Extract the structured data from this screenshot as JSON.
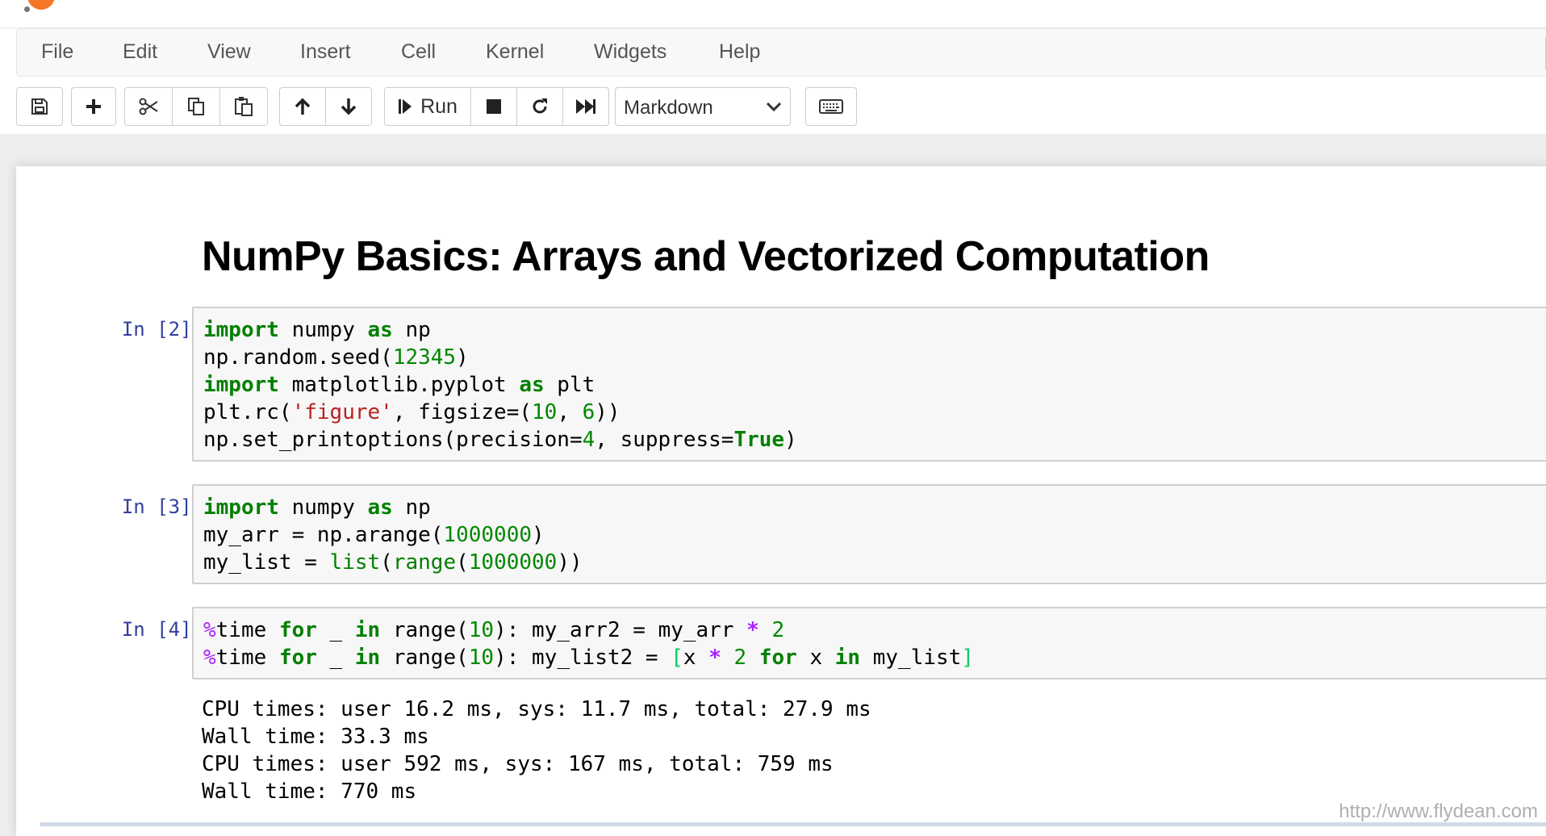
{
  "menubar": {
    "items": [
      "File",
      "Edit",
      "View",
      "Insert",
      "Cell",
      "Kernel",
      "Widgets",
      "Help"
    ]
  },
  "toolbar": {
    "run_label": "Run",
    "cell_type": "Markdown"
  },
  "notebook": {
    "title": "NumPy Basics: Arrays and Vectorized Computation",
    "cells": [
      {
        "prompt": "In [2]:",
        "lines": [
          [
            [
              "kw",
              "import"
            ],
            [
              "t",
              " numpy "
            ],
            [
              "kw",
              "as"
            ],
            [
              "t",
              " np"
            ]
          ],
          [
            [
              "t",
              "np.random.seed("
            ],
            [
              "num",
              "12345"
            ],
            [
              "t",
              ")"
            ]
          ],
          [
            [
              "kw",
              "import"
            ],
            [
              "t",
              " matplotlib.pyplot "
            ],
            [
              "kw",
              "as"
            ],
            [
              "t",
              " plt"
            ]
          ],
          [
            [
              "t",
              "plt.rc("
            ],
            [
              "str",
              "'figure'"
            ],
            [
              "t",
              ", figsize=("
            ],
            [
              "num",
              "10"
            ],
            [
              "t",
              ", "
            ],
            [
              "num",
              "6"
            ],
            [
              "t",
              "))"
            ]
          ],
          [
            [
              "t",
              "np.set_printoptions(precision="
            ],
            [
              "num",
              "4"
            ],
            [
              "t",
              ", suppress="
            ],
            [
              "kw",
              "True"
            ],
            [
              "t",
              ")"
            ]
          ]
        ]
      },
      {
        "prompt": "In [3]:",
        "lines": [
          [
            [
              "kw",
              "import"
            ],
            [
              "t",
              " numpy "
            ],
            [
              "kw",
              "as"
            ],
            [
              "t",
              " np"
            ]
          ],
          [
            [
              "t",
              "my_arr = np.arange("
            ],
            [
              "num",
              "1000000"
            ],
            [
              "t",
              ")"
            ]
          ],
          [
            [
              "t",
              "my_list = "
            ],
            [
              "bi",
              "list"
            ],
            [
              "t",
              "("
            ],
            [
              "bi",
              "range"
            ],
            [
              "t",
              "("
            ],
            [
              "num",
              "1000000"
            ],
            [
              "t",
              "))"
            ]
          ]
        ]
      },
      {
        "prompt": "In [4]:",
        "lines": [
          [
            [
              "magic",
              "%"
            ],
            [
              "t",
              "time "
            ],
            [
              "kw",
              "for"
            ],
            [
              "t",
              " _ "
            ],
            [
              "kw",
              "in"
            ],
            [
              "t",
              " range("
            ],
            [
              "num",
              "10"
            ],
            [
              "t",
              "): my_arr2 = my_arr "
            ],
            [
              "op",
              "*"
            ],
            [
              "t",
              " "
            ],
            [
              "num",
              "2"
            ]
          ],
          [
            [
              "magic",
              "%"
            ],
            [
              "t",
              "time "
            ],
            [
              "kw",
              "for"
            ],
            [
              "t",
              " _ "
            ],
            [
              "kw",
              "in"
            ],
            [
              "t",
              " range("
            ],
            [
              "num",
              "10"
            ],
            [
              "t",
              "): my_list2 = "
            ],
            [
              "br",
              "["
            ],
            [
              "t",
              "x "
            ],
            [
              "op",
              "*"
            ],
            [
              "t",
              " "
            ],
            [
              "num",
              "2"
            ],
            [
              "t",
              " "
            ],
            [
              "kw",
              "for"
            ],
            [
              "t",
              " x "
            ],
            [
              "kw",
              "in"
            ],
            [
              "t",
              " my_list"
            ],
            [
              "br",
              "]"
            ]
          ]
        ],
        "output": [
          "CPU times: user 16.2 ms, sys: 11.7 ms, total: 27.9 ms",
          "Wall time: 33.3 ms",
          "CPU times: user 592 ms, sys: 167 ms, total: 759 ms",
          "Wall time: 770 ms"
        ]
      }
    ]
  },
  "watermark": "http://www.flydean.com",
  "colors": {
    "prompt": "#303f9f",
    "keyword": "#008000",
    "string": "#ba2121",
    "operator": "#aa22ff",
    "brand_orange": "#f37726"
  }
}
